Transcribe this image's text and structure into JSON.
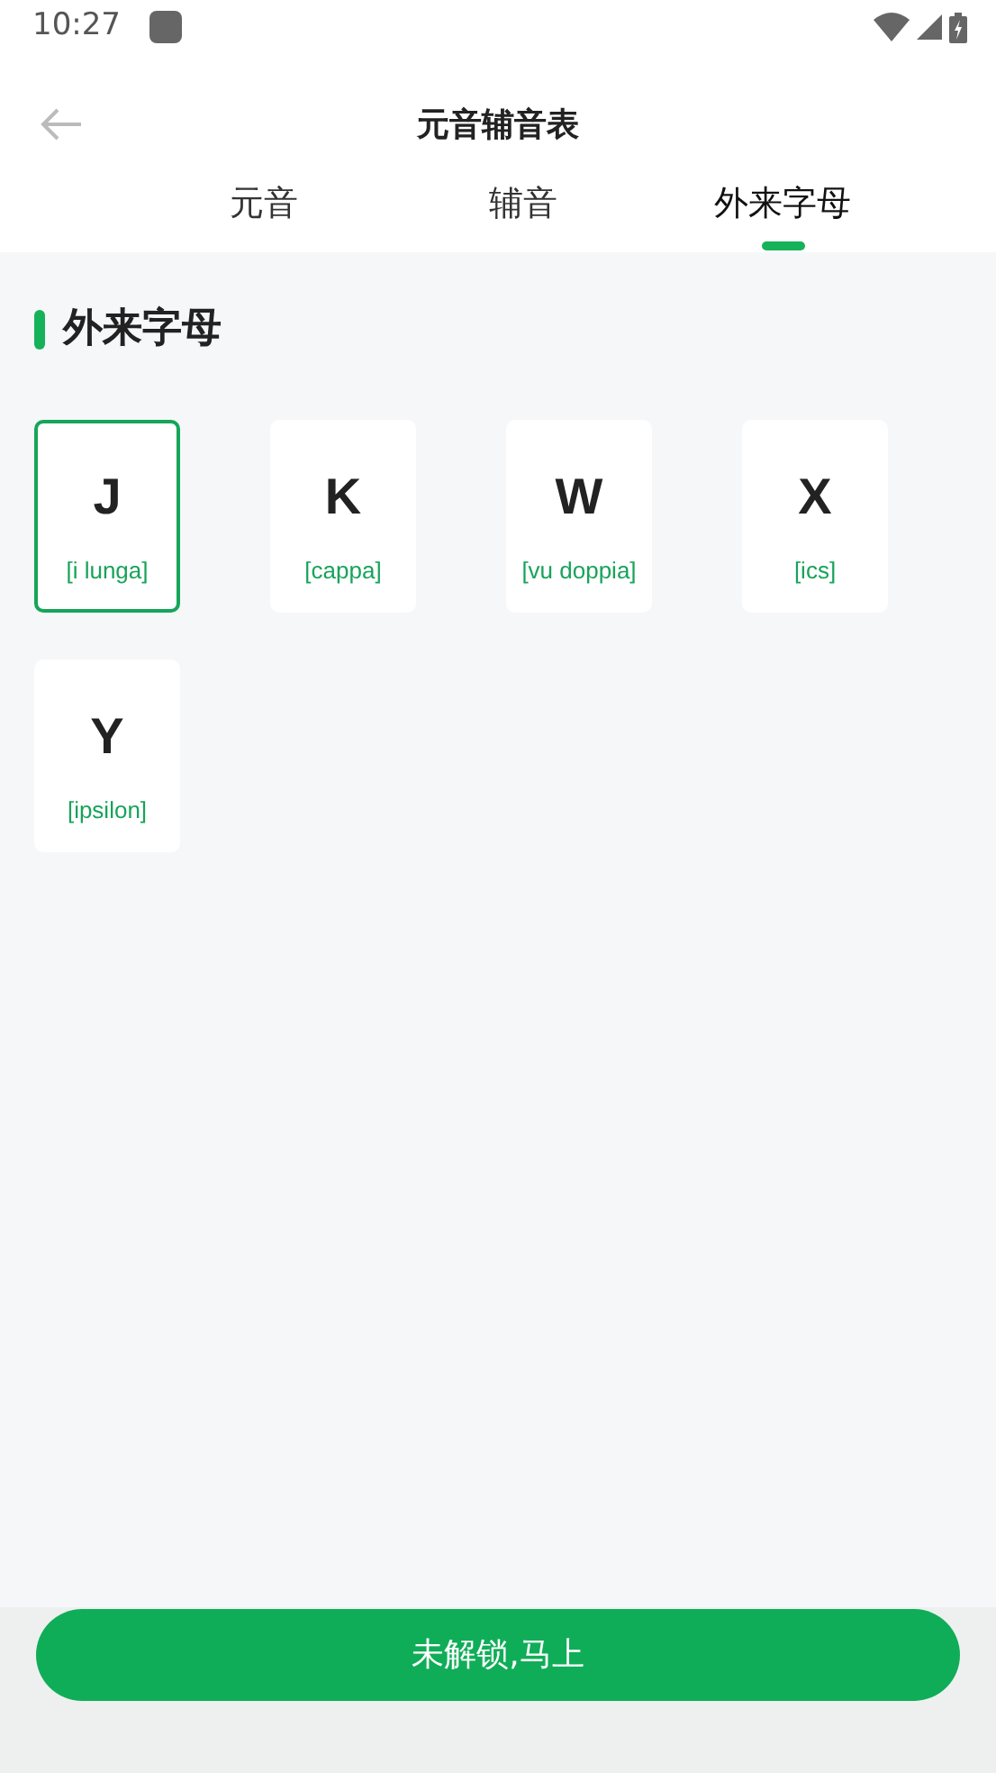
{
  "status_bar": {
    "time": "10:27"
  },
  "header": {
    "title": "元音辅音表"
  },
  "tabs": [
    {
      "label": "元音",
      "selected": false
    },
    {
      "label": "辅音",
      "selected": false
    },
    {
      "label": "外来字母",
      "selected": true
    }
  ],
  "section": {
    "title": "外来字母"
  },
  "letters": [
    {
      "letter": "J",
      "name": "[i lunga]",
      "selected": true
    },
    {
      "letter": "K",
      "name": "[cappa]",
      "selected": false
    },
    {
      "letter": "W",
      "name": "[vu doppia]",
      "selected": false
    },
    {
      "letter": "X",
      "name": "[ics]",
      "selected": false
    },
    {
      "letter": "Y",
      "name": "[ipsilon]",
      "selected": false
    }
  ],
  "unlock_button": {
    "label": "未解锁,马上"
  }
}
